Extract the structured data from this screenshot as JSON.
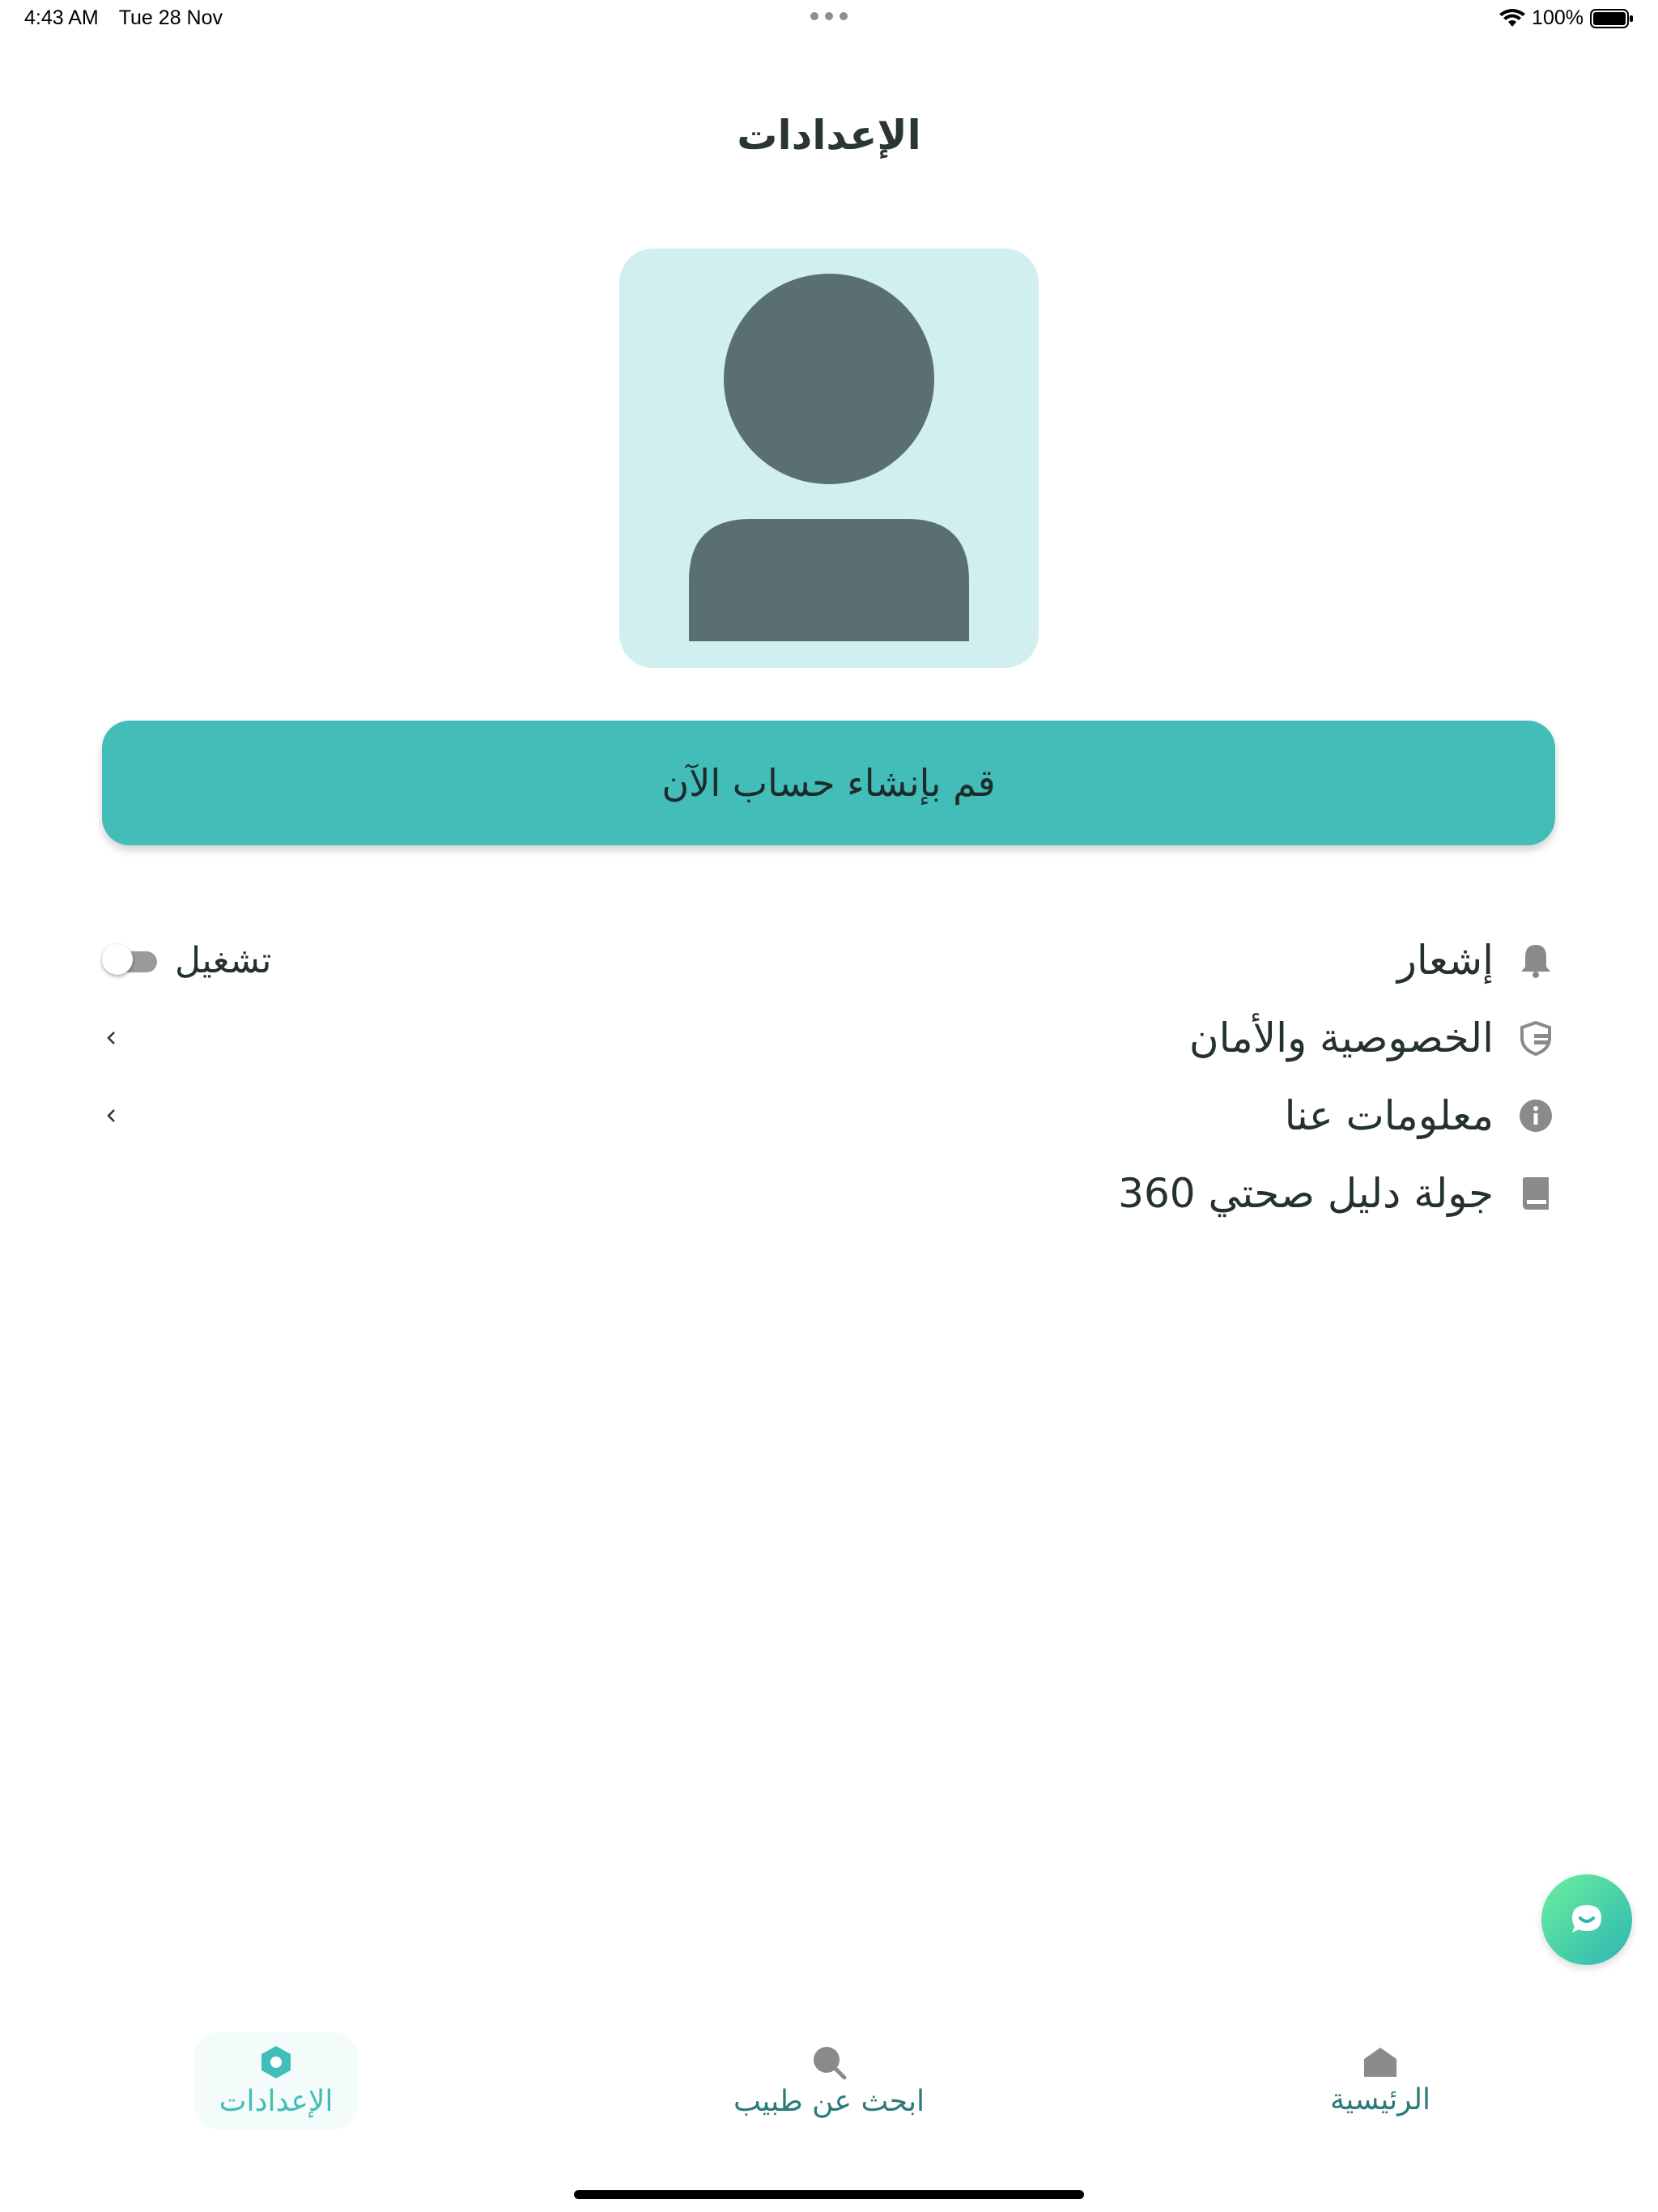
{
  "status_bar": {
    "time": "4:43 AM",
    "date": "Tue 28 Nov",
    "battery": "100%"
  },
  "header": {
    "title": "الإعدادات"
  },
  "profile": {
    "avatar_icon": "person-icon"
  },
  "create_account": {
    "label": "قم بإنشاء حساب الآن"
  },
  "settings_rows": [
    {
      "label": "إشعار",
      "icon": "bell-icon",
      "toggle_label": "تشغيل",
      "toggle_on": false
    },
    {
      "label": "الخصوصية والأمان",
      "icon": "shield-icon"
    },
    {
      "label": "معلومات عنا",
      "icon": "info-icon"
    },
    {
      "label": "جولة دليل صحتي 360",
      "icon": "book-icon"
    }
  ],
  "bottom_nav": {
    "items": [
      {
        "label": "الإعدادات",
        "icon": "settings-icon",
        "active": true
      },
      {
        "label": "ابحث عن طبيب",
        "icon": "search-icon",
        "active": false
      },
      {
        "label": "الرئيسية",
        "icon": "home-icon",
        "active": false
      }
    ]
  },
  "colors": {
    "accent": "#42bdb8",
    "avatar_bg": "#d0efee",
    "avatar_fg": "#5a7070",
    "icon_gray": "#8a8a8a"
  }
}
